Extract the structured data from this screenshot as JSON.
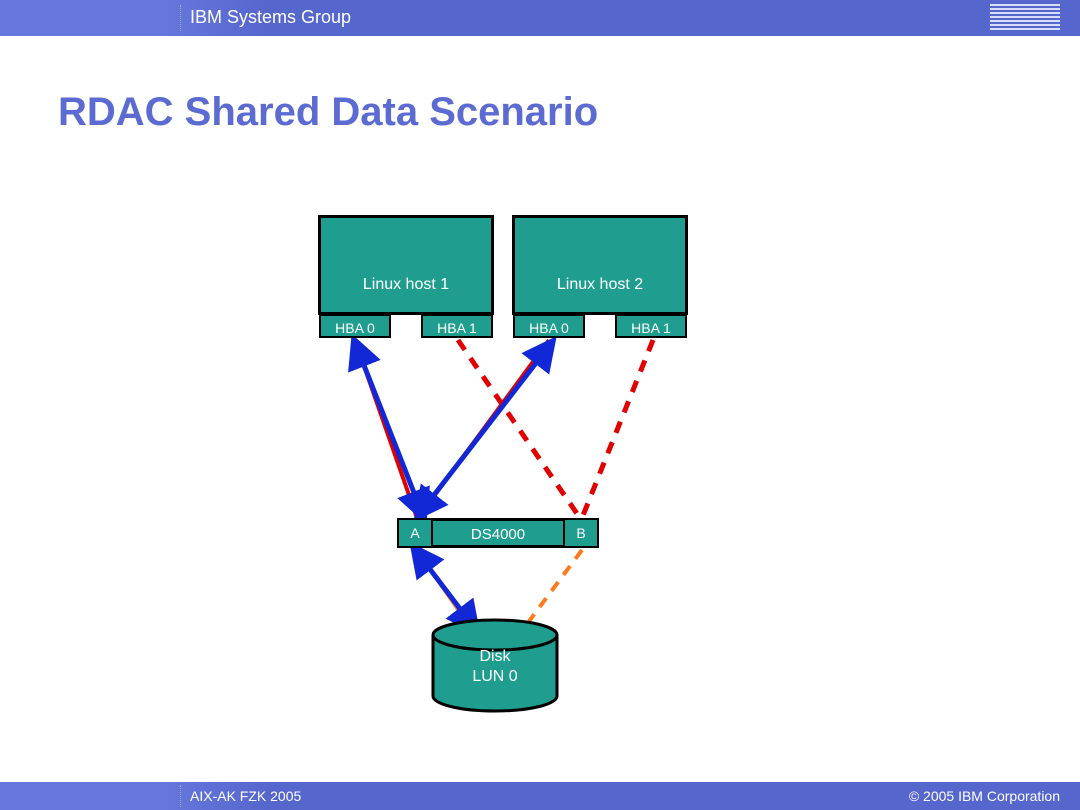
{
  "header": {
    "group_label": "IBM Systems Group"
  },
  "footer": {
    "left_label": "AIX-AK FZK 2005",
    "right_label": "© 2005 IBM Corporation"
  },
  "title": "RDAC Shared Data Scenario",
  "diagram": {
    "hosts": [
      {
        "label": "Linux host 1",
        "hba_left": "HBA 0",
        "hba_right": "HBA 1"
      },
      {
        "label": "Linux host 2",
        "hba_left": "HBA 0",
        "hba_right": "HBA 1"
      }
    ],
    "array": {
      "label": "DS4000",
      "port_left": "A",
      "port_right": "B"
    },
    "disk": {
      "line1": "Disk",
      "line2": "LUN 0"
    },
    "connections": {
      "solid_red_paths": [
        "host1.HBA0 -> DS4000.A (active)",
        "host2.HBA0 -> DS4000.A (active)"
      ],
      "solid_blue_arrows": [
        "DS4000.A <-> host1.HBA0 (data)",
        "DS4000.A <-> host2.HBA0 (data)",
        "DS4000.A <-> Disk (data)"
      ],
      "dashed_red_paths": [
        "host1.HBA1 -> DS4000.B (standby)",
        "host2.HBA1 -> DS4000.B (standby)"
      ],
      "dashed_orange_path": "DS4000.B -> Disk (standby)",
      "solid_orange_path": "DS4000.A -> Disk (active)"
    }
  }
}
